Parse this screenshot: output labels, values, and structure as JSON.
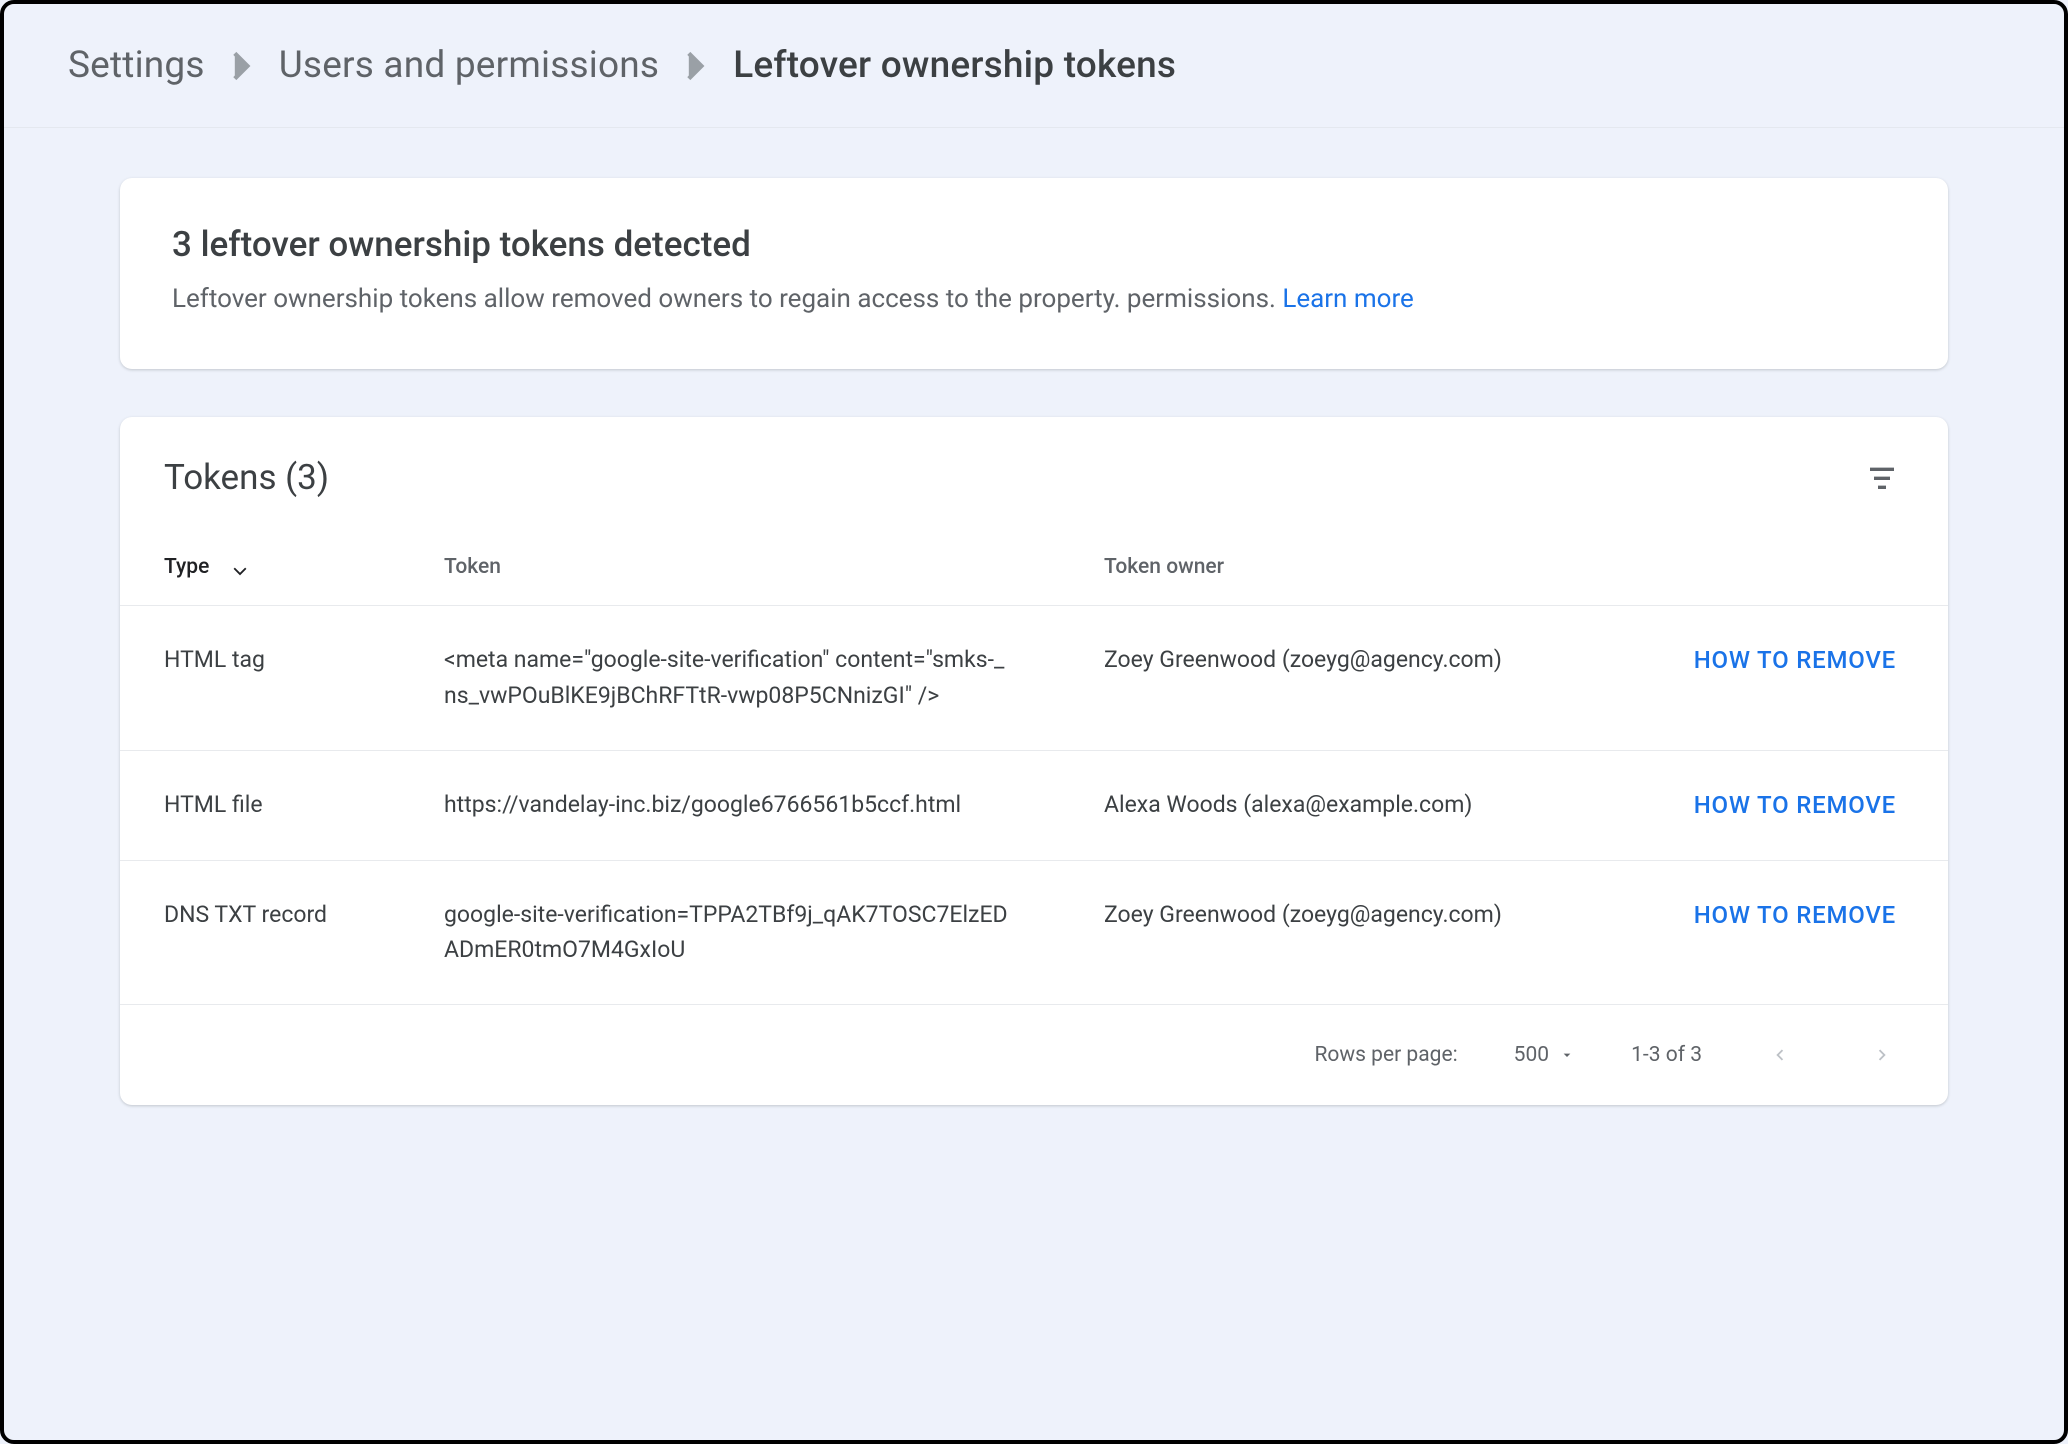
{
  "breadcrumb": {
    "items": [
      {
        "label": "Settings"
      },
      {
        "label": "Users and permissions"
      },
      {
        "label": "Leftover ownership tokens"
      }
    ]
  },
  "alert": {
    "title": "3 leftover ownership tokens detected",
    "body_before_link": "Leftover ownership tokens allow removed owners to regain access to the property. permissions. ",
    "learn_more": "Learn more"
  },
  "tokens_card": {
    "title": "Tokens (3)",
    "columns": {
      "type": "Type",
      "token": "Token",
      "owner": "Token owner"
    },
    "action_label": "HOW TO REMOVE",
    "rows": [
      {
        "type": "HTML tag",
        "token": "<meta name=\"google-site-verification\" content=\"smks-_ns_vwPOuBlKE9jBChRFTtR-vwp08P5CNnizGI\" />",
        "owner": "Zoey Greenwood (zoeyg@agency.com)"
      },
      {
        "type": "HTML file",
        "token": "https://vandelay-inc.biz/google6766561b5ccf.html",
        "owner": "Alexa Woods (alexa@example.com)"
      },
      {
        "type": "DNS TXT record",
        "token": "google-site-verification=TPPA2TBf9j_qAK7TOSC7ElzEDADmER0tmO7M4GxIoU",
        "owner": "Zoey Greenwood (zoeyg@agency.com)"
      }
    ],
    "pagination": {
      "rows_per_page_label": "Rows per page:",
      "rows_per_page_value": "500",
      "range": "1-3 of 3"
    }
  }
}
